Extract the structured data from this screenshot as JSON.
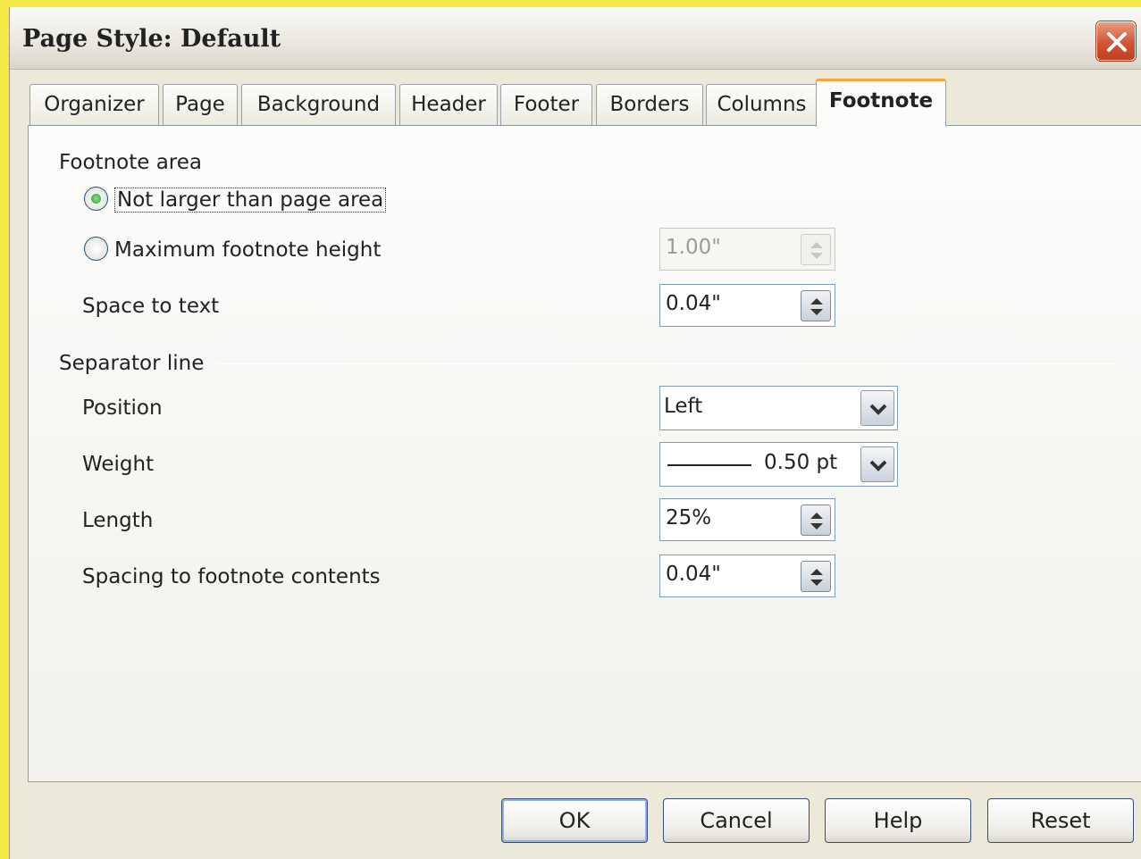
{
  "window": {
    "title": "Page Style: Default"
  },
  "tabs": [
    {
      "label": "Organizer",
      "active": false
    },
    {
      "label": "Page",
      "active": false
    },
    {
      "label": "Background",
      "active": false
    },
    {
      "label": "Header",
      "active": false
    },
    {
      "label": "Footer",
      "active": false
    },
    {
      "label": "Borders",
      "active": false
    },
    {
      "label": "Columns",
      "active": false
    },
    {
      "label": "Footnote",
      "active": true
    }
  ],
  "footnote_area": {
    "heading": "Footnote area",
    "option_not_larger": {
      "label": "Not larger than page area",
      "selected": true
    },
    "option_max_height": {
      "label": "Maximum footnote height",
      "selected": false,
      "value": "1.00\"",
      "enabled": false
    },
    "space_to_text": {
      "label": "Space to text",
      "value": "0.04\""
    }
  },
  "separator_line": {
    "heading": "Separator line",
    "position": {
      "label": "Position",
      "value": "Left"
    },
    "weight": {
      "label": "Weight",
      "value": "0.50 pt"
    },
    "length": {
      "label": "Length",
      "value": "25%"
    },
    "spacing": {
      "label": "Spacing to footnote contents",
      "value": "0.04\""
    }
  },
  "buttons": {
    "ok": "OK",
    "cancel": "Cancel",
    "help": "Help",
    "reset": "Reset"
  },
  "icons": {
    "close": "close-icon",
    "spin": "spin-arrows-icon",
    "dropdown": "chevron-down-icon"
  },
  "colors": {
    "background_highlight": "#f5e94a",
    "close_button": "#d0553a",
    "active_tab_accent": "#f2a33a",
    "radio_selected": "#2b9b2b"
  }
}
